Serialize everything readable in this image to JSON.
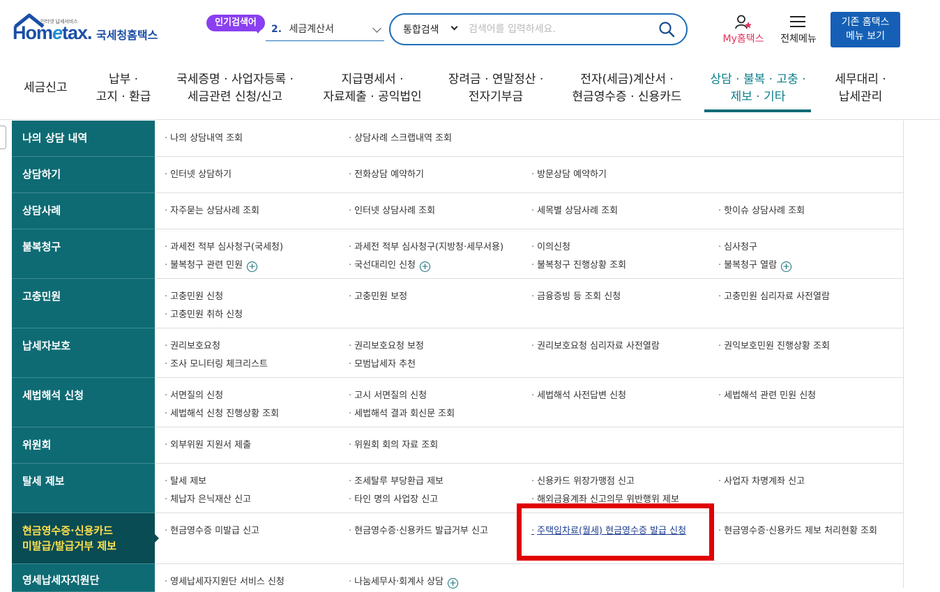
{
  "header": {
    "logo_small": "인터넷 납세서비스",
    "logo_en_prefix": "Hom",
    "logo_en_e": "e",
    "logo_en_suffix": "tax.",
    "logo_kr": "국세청홈택스",
    "popular_badge": "인기검색어",
    "popular_rank": "2.",
    "popular_term": "세금계산서",
    "search_scope": "통합검색",
    "search_placeholder": "검색어를 입력하세요.",
    "my_hometax": "My홈택스",
    "all_menu": "전체메뉴",
    "old_menu_line1": "기존 홈택스",
    "old_menu_line2": "메뉴 보기"
  },
  "gnb": [
    {
      "line1": "세금신고",
      "line2": ""
    },
    {
      "line1": "납부 ·",
      "line2": "고지 · 환급"
    },
    {
      "line1": "국세증명 · 사업자등록 ·",
      "line2": "세금관련 신청/신고"
    },
    {
      "line1": "지급명세서 ·",
      "line2": "자료제출 · 공익법인"
    },
    {
      "line1": "장려금 · 연말정산 ·",
      "line2": "전자기부금"
    },
    {
      "line1": "전자(세금)계산서 ·",
      "line2": "현금영수증 · 신용카드"
    },
    {
      "line1": "상담 · 불복 · 고충 ·",
      "line2": "제보 · 기타"
    },
    {
      "line1": "세무대리 ·",
      "line2": "납세관리"
    }
  ],
  "rows": [
    {
      "cat": "나의 상담 내역",
      "links": [
        [
          "나의 상담내역 조회"
        ],
        [
          "상담사례 스크랩내역 조회"
        ]
      ]
    },
    {
      "cat": "상담하기",
      "links": [
        [
          "인터넷 상담하기"
        ],
        [
          "전화상담 예약하기"
        ],
        [
          "방문상담 예약하기"
        ]
      ]
    },
    {
      "cat": "상담사례",
      "links": [
        [
          "자주묻는 상담사례 조회"
        ],
        [
          "인터넷 상담사례 조회"
        ],
        [
          "세목별 상담사례 조회"
        ],
        [
          "핫이슈 상담사례 조회"
        ]
      ]
    },
    {
      "cat": "불복청구",
      "links": [
        [
          "과세전 적부 심사청구(국세청)",
          "불복청구 관련 민원"
        ],
        [
          "과세전 적부 심사청구(지방청·세무서용)",
          "국선대리인 신청"
        ],
        [
          "이의신청",
          "불복청구 진행상황 조회"
        ],
        [
          "심사청구",
          "불복청구 열람"
        ]
      ]
    },
    {
      "cat": "고충민원",
      "links": [
        [
          "고충민원 신청",
          "고충민원 취하 신청"
        ],
        [
          "고충민원 보정"
        ],
        [
          "금융증빙 등 조회 신청"
        ],
        [
          "고충민원 심리자료 사전열람"
        ]
      ]
    },
    {
      "cat": "납세자보호",
      "links": [
        [
          "권리보호요청",
          "조사 모니터링 체크리스트"
        ],
        [
          "권리보호요청 보정",
          "모범납세자 추천"
        ],
        [
          "권리보호요청 심리자료 사전열람"
        ],
        [
          "권익보호민원 진행상황 조회"
        ]
      ]
    },
    {
      "cat": "세법해석 신청",
      "links": [
        [
          "서면질의 신청",
          "세법해석 신청 진행상황 조회"
        ],
        [
          "고시 서면질의 신청",
          "세법해석 결과 회신문 조회"
        ],
        [
          "세법해석 사전답변 신청"
        ],
        [
          "세법해석 관련 민원 신청"
        ]
      ]
    },
    {
      "cat": "위원회",
      "links": [
        [
          "외부위원 지원서 제출"
        ],
        [
          "위원회 회의 자료 조회"
        ]
      ]
    },
    {
      "cat": "탈세 제보",
      "links": [
        [
          "탈세 제보",
          "체납자 은닉재산 신고"
        ],
        [
          "조세탈루 부당환급 제보",
          "타인 명의 사업장 신고"
        ],
        [
          "신용카드 위장가맹점 신고",
          "해외금융계좌 신고의무 위반행위 제보"
        ],
        [
          "사업자 차명계좌 신고"
        ]
      ]
    },
    {
      "cat_line1": "현금영수증·신용카드",
      "cat_line2": "미발급/발급거부 제보",
      "links": [
        [
          "현금영수증 미발급 신고"
        ],
        [
          "현금영수증·신용카드 발급거부 신고"
        ],
        [
          "주택임차료(월세) 현금영수증 발급 신청"
        ],
        [
          "현금영수증·신용카드 제보 처리현황 조회"
        ]
      ]
    },
    {
      "cat": "영세납세자지원단",
      "links": [
        [
          "영세납세자지원단 서비스 신청"
        ],
        [
          "나눔세무사·회계사 상담"
        ]
      ]
    }
  ],
  "colors": {
    "brand": "#1b4fa6",
    "category_bg": "#0e6b74",
    "category_selected_bg": "#0a4c53",
    "highlight_box": "#e00000",
    "popular_badge": "#8a3ff0"
  }
}
